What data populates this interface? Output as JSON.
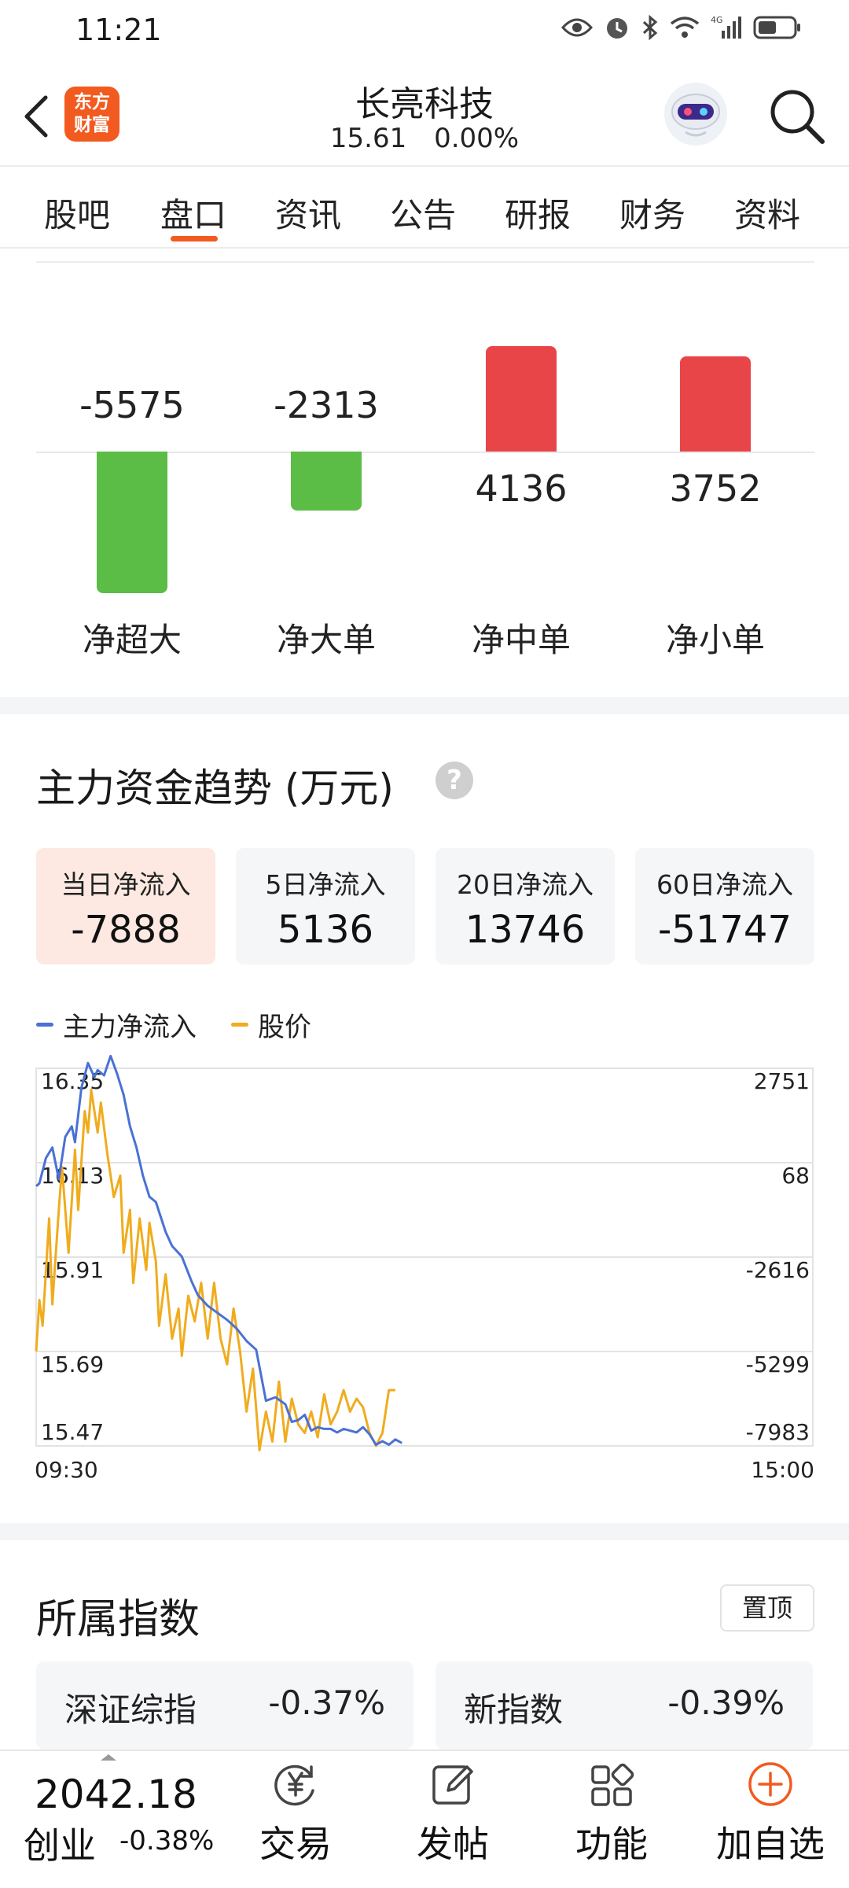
{
  "status_bar": {
    "time": "11:21"
  },
  "header": {
    "logo_line1": "东方",
    "logo_line2": "财富",
    "stock_name": "长亮科技",
    "price": "15.61",
    "change_pct": "0.00%"
  },
  "tabs": [
    "股吧",
    "盘口",
    "资讯",
    "公告",
    "研报",
    "财务",
    "资料"
  ],
  "active_tab": "盘口",
  "net_flow": {
    "bars": [
      {
        "label": "净超大",
        "value": "-5575",
        "amount": -5575,
        "color": "#5bbd45"
      },
      {
        "label": "净大单",
        "value": "-2313",
        "amount": -2313,
        "color": "#5bbd45"
      },
      {
        "label": "净中单",
        "value": "4136",
        "amount": 4136,
        "color": "#e84549"
      },
      {
        "label": "净小单",
        "value": "3752",
        "amount": 3752,
        "color": "#e84549"
      }
    ]
  },
  "trend": {
    "title": "主力资金趋势 (万元)",
    "help_icon": "question-circle-icon",
    "periods": [
      {
        "label": "当日净流入",
        "value": "-7888",
        "active": true
      },
      {
        "label": "5日净流入",
        "value": "5136",
        "active": false
      },
      {
        "label": "20日净流入",
        "value": "13746",
        "active": false
      },
      {
        "label": "60日净流入",
        "value": "-51747",
        "active": false
      }
    ],
    "legend": [
      {
        "name": "主力净流入",
        "color": "#4a72d4"
      },
      {
        "name": "股价",
        "color": "#f0ac1e"
      }
    ]
  },
  "chart_data": {
    "type": "line",
    "x_start_label": "09:30",
    "x_end_label": "15:00",
    "left_axis_ticks": [
      "16.35",
      "16.13",
      "15.91",
      "15.69",
      "15.47"
    ],
    "right_axis_ticks": [
      "2751",
      "68",
      "-2616",
      "-5299",
      "-7983"
    ],
    "left_ylim": [
      15.47,
      16.35
    ],
    "right_ylim": [
      -7983,
      2751
    ],
    "x_total_minutes": 240,
    "grid": true,
    "series": [
      {
        "name": "主力净流入",
        "axis": "right",
        "color": "#4a72d4",
        "x": [
          0,
          1,
          3,
          5,
          7,
          9,
          11,
          12,
          14,
          16,
          18,
          19,
          21,
          23,
          25,
          27,
          29,
          31,
          33,
          35,
          37,
          40,
          42,
          45,
          48,
          50,
          53,
          56,
          59,
          62,
          65,
          68,
          71,
          74,
          77,
          79,
          81,
          83,
          85,
          87,
          89,
          91,
          93,
          95,
          97,
          99,
          101,
          103,
          105,
          107,
          109,
          111,
          113
        ],
        "values": [
          -600,
          -520,
          200,
          500,
          -400,
          800,
          1100,
          650,
          2200,
          2900,
          2500,
          2700,
          2550,
          3100,
          2600,
          2000,
          1100,
          500,
          -300,
          -900,
          -1050,
          -1900,
          -2300,
          -2600,
          -3300,
          -3700,
          -4000,
          -4200,
          -4400,
          -4650,
          -5000,
          -5250,
          -6700,
          -6600,
          -6800,
          -7300,
          -7250,
          -7100,
          -7550,
          -7450,
          -7500,
          -7500,
          -7600,
          -7500,
          -7550,
          -7600,
          -7450,
          -7650,
          -7950,
          -7850,
          -7950,
          -7800,
          -7900
        ]
      },
      {
        "name": "股价",
        "axis": "left",
        "color": "#f0ac1e",
        "x": [
          0,
          1,
          2,
          4,
          5,
          7,
          8,
          10,
          12,
          13,
          15,
          16,
          17,
          19,
          20,
          22,
          24,
          26,
          27,
          29,
          30,
          32,
          34,
          35,
          37,
          38,
          40,
          42,
          44,
          45,
          47,
          49,
          51,
          53,
          55,
          57,
          59,
          61,
          63,
          65,
          67,
          69,
          71,
          73,
          75,
          77,
          79,
          81,
          83,
          85,
          87,
          89,
          91,
          93,
          95,
          97,
          99,
          101,
          103,
          105,
          107,
          109,
          111
        ],
        "values": [
          15.69,
          15.81,
          15.75,
          16.0,
          15.8,
          16.02,
          16.12,
          15.92,
          16.16,
          16.02,
          16.25,
          16.2,
          16.3,
          16.2,
          16.27,
          16.15,
          16.05,
          16.1,
          15.92,
          16.02,
          15.85,
          16.0,
          15.88,
          15.99,
          15.9,
          15.75,
          15.87,
          15.72,
          15.79,
          15.68,
          15.82,
          15.76,
          15.85,
          15.72,
          15.85,
          15.72,
          15.66,
          15.79,
          15.69,
          15.55,
          15.65,
          15.46,
          15.55,
          15.48,
          15.62,
          15.48,
          15.58,
          15.52,
          15.5,
          15.55,
          15.49,
          15.59,
          15.52,
          15.55,
          15.6,
          15.55,
          15.58,
          15.56,
          15.5,
          15.47,
          15.5,
          15.6,
          15.6
        ]
      }
    ]
  },
  "indices": {
    "title": "所属指数",
    "pin_label": "置顶",
    "items": [
      {
        "name": "深证综指",
        "change": "-0.37%"
      },
      {
        "name": "新指数",
        "change": "-0.39%"
      }
    ]
  },
  "bottom_bar": {
    "index_value": "2042.18",
    "index_name": "创业",
    "index_change": "-0.38%",
    "items": [
      {
        "label": "交易",
        "icon": "yen-refresh-icon"
      },
      {
        "label": "发帖",
        "icon": "edit-post-icon"
      },
      {
        "label": "功能",
        "icon": "grid-apps-icon"
      },
      {
        "label": "加自选",
        "icon": "add-circle-icon",
        "color": "#f25a1f"
      }
    ]
  }
}
